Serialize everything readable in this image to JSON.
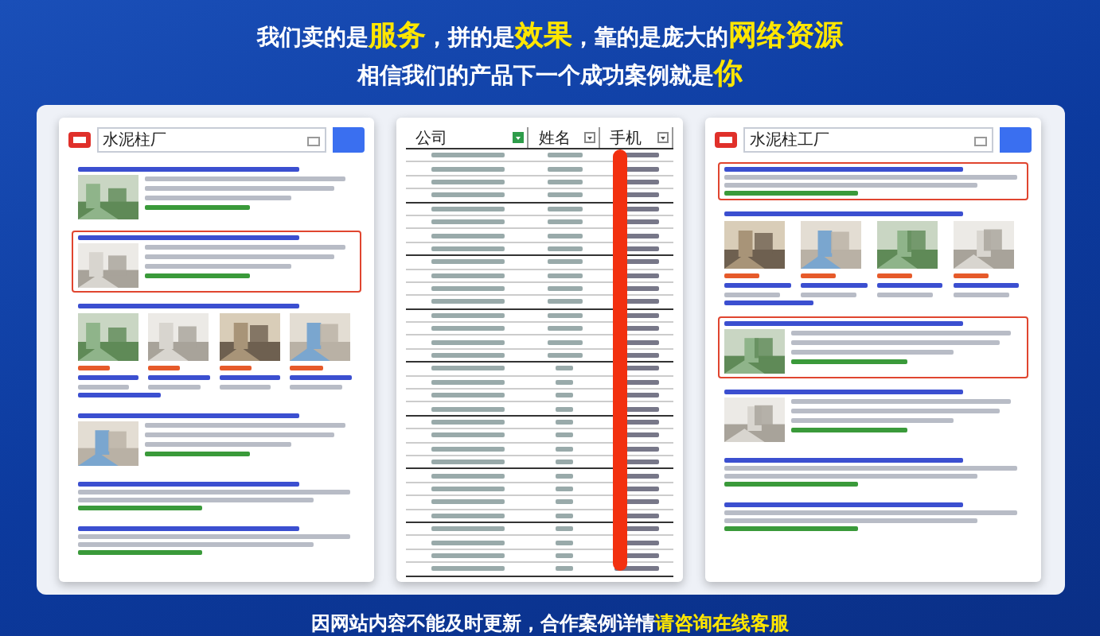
{
  "headline": {
    "line_1": "我们卖的是**服务**，拼的是**效果**，靠的是庞大的**网络资源**",
    "line_2": "相信我们的产品下一个成功案例就是**你**"
  },
  "panels": [
    {
      "kind": "search",
      "query": "水泥柱厂",
      "results": [
        {
          "kind": "thumb",
          "highlighted": false
        },
        {
          "kind": "thumb",
          "highlighted": true
        },
        {
          "kind": "gallery",
          "highlighted": false
        },
        {
          "kind": "thumb",
          "highlighted": false
        },
        {
          "kind": "text",
          "highlighted": false
        },
        {
          "kind": "text",
          "highlighted": false
        }
      ]
    },
    {
      "kind": "table",
      "columns": [
        {
          "label": "公司",
          "filtered": true
        },
        {
          "label": "姓名",
          "filtered": false
        },
        {
          "label": "手机",
          "filtered": false
        }
      ]
    },
    {
      "kind": "search",
      "query": "水泥柱工厂",
      "results": [
        {
          "kind": "text",
          "highlighted": true
        },
        {
          "kind": "gallery",
          "highlighted": false
        },
        {
          "kind": "thumb",
          "highlighted": true
        },
        {
          "kind": "thumb",
          "highlighted": false
        },
        {
          "kind": "text",
          "highlighted": false
        },
        {
          "kind": "text",
          "highlighted": false
        }
      ]
    }
  ],
  "footer": "因网站内容不能及时更新，合作案例详情**请咨询在线客服**"
}
